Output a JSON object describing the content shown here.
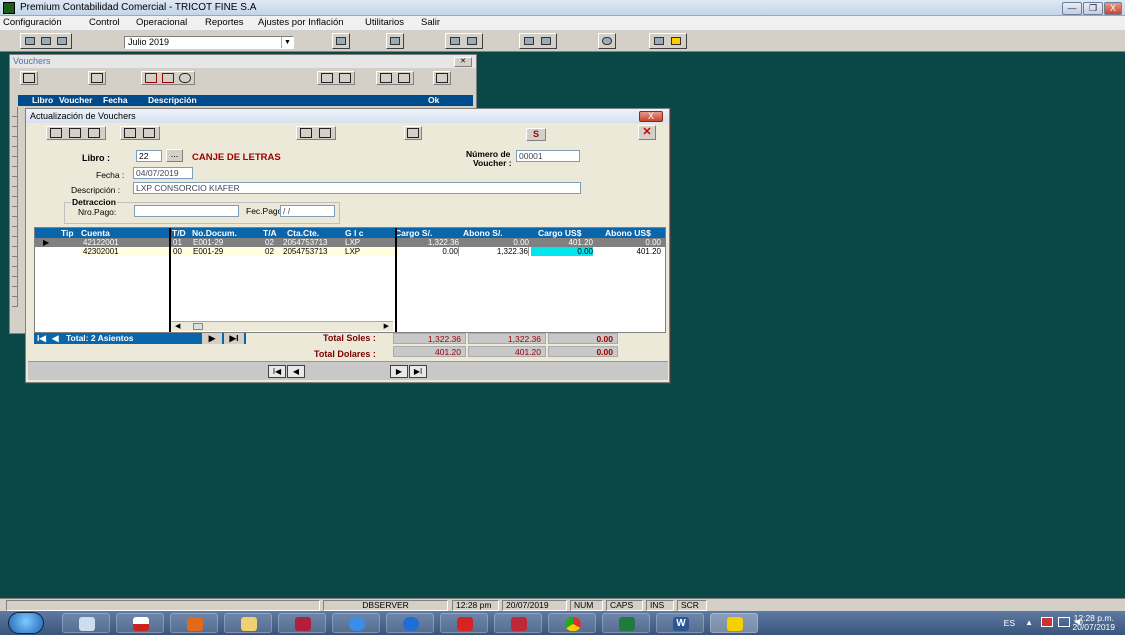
{
  "app": {
    "title": "Premium Contabilidad Comercial - TRICOT FINE S.A",
    "min": "—",
    "max": "❐",
    "close": "X"
  },
  "menu": [
    "Configuración",
    "Control",
    "Operacional",
    "Reportes",
    "Ajustes por Inflación",
    "Utilitarios",
    "Salir"
  ],
  "toolbar": {
    "period": "Julio 2019"
  },
  "vouchers_window": {
    "title": "Vouchers",
    "close": "✕",
    "columns": [
      "Libro",
      "Voucher",
      "Fecha",
      "Descripción",
      "Ok"
    ]
  },
  "form": {
    "title": "Actualización de Vouchers",
    "close": "X",
    "s_button": "S",
    "libro_label": "Libro :",
    "libro_value": "22",
    "libro_btn": "...",
    "libro_name": "CANJE DE LETRAS",
    "numero_label_1": "Número de",
    "numero_label_2": "Voucher :",
    "numero_value": "00001",
    "fecha_label": "Fecha :",
    "fecha_value": "04/07/2019",
    "descripcion_label": "Descripción :",
    "descripcion_value": "LXP CONSORCIO KIAFER",
    "detraccion_label": "Detraccion",
    "nro_pago_label": "Nro.Pago:",
    "nro_pago_value": "",
    "fec_pago_label": "Fec.Pago",
    "fec_pago_value": "/ /"
  },
  "grid": {
    "columns": [
      "Tip",
      "Cuenta",
      "T/D",
      "No.Docum.",
      "T/A",
      "Cta.Cte.",
      "G l c",
      "Cargo S/.",
      "Abono S/.",
      "Cargo US$",
      "Abono US$"
    ],
    "rows": [
      {
        "marker": "▶",
        "cuenta": "42122001",
        "td": "01",
        "doc": "E001-29",
        "ta": "02",
        "ctacte": "2054753713",
        "glosa": "LXP",
        "cargo_s": "1,322.36",
        "abono_s": "0.00",
        "cargo_usd": "401.20",
        "abono_usd": "0.00"
      },
      {
        "marker": "",
        "cuenta": "42302001",
        "td": "00",
        "doc": "E001-29",
        "ta": "02",
        "ctacte": "2054753713",
        "glosa": "LXP",
        "cargo_s": "0.00",
        "abono_s": "1,322.36",
        "cargo_usd": "0.00",
        "abono_usd": "401.20"
      }
    ]
  },
  "footer": {
    "nav_first": "I◀",
    "nav_prev": "◀",
    "total_asientos": "Total: 2 Asientos",
    "nav_next": "▶",
    "nav_last": "▶I",
    "total_soles_label": "Total Soles :",
    "total_soles_cargo": "1,322.36",
    "total_soles_abono": "1,322.36",
    "total_soles_diff": "0.00",
    "total_dolares_label": "Total Dolares :",
    "total_dolares_cargo": "401.20",
    "total_dolares_abono": "401.20",
    "total_dolares_diff": "0.00"
  },
  "status": {
    "server": "DBSERVER",
    "time": "12:28 pm",
    "date": "20/07/2019",
    "num": "NUM",
    "caps": "CAPS",
    "ins": "INS",
    "scr": "SCR"
  },
  "taskbar": {
    "lang": "ES",
    "clock_time": "12:28 p.m.",
    "clock_date": "20/07/2019",
    "word_icon": "W"
  },
  "colors": {
    "desktop": "#0a4747",
    "grid_header": "#0a66aa",
    "highlight_cell": "#00e5ee",
    "accent_red": "#990000"
  }
}
